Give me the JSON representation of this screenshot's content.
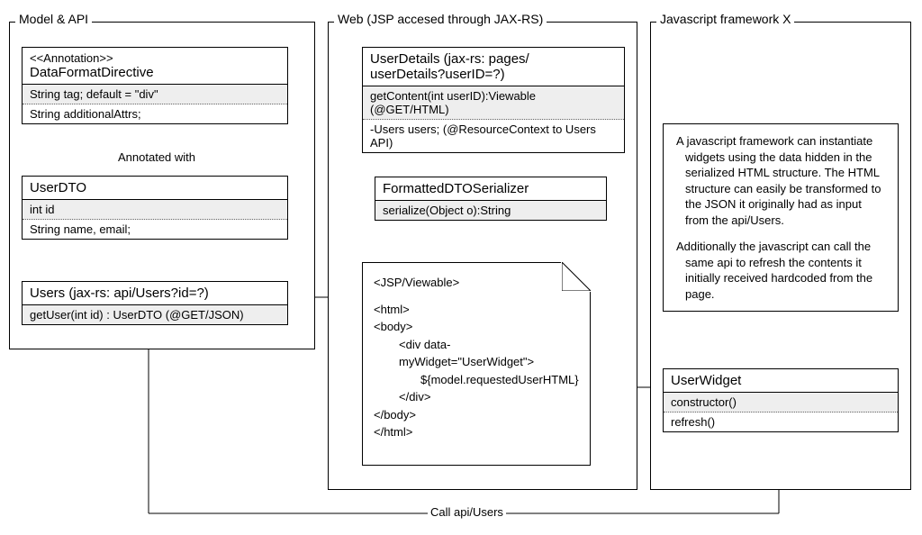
{
  "containers": {
    "model": {
      "label": "Model & API"
    },
    "web": {
      "label": "Web (JSP accesed through JAX-RS)"
    },
    "js": {
      "label": "Javascript framework X"
    }
  },
  "classes": {
    "dfd": {
      "stereo": "<<Annotation>>",
      "name": "DataFormatDirective",
      "row1": "String tag; default = \"div\"",
      "row2": "String additionalAttrs;"
    },
    "userdto": {
      "name": "UserDTO",
      "row1": "int id",
      "row2": "String name, email;"
    },
    "users": {
      "name": "Users (jax-rs: api/Users?id=?)",
      "row1": "getUser(int id) : UserDTO (@GET/JSON)"
    },
    "userdetails": {
      "name": "UserDetails (jax-rs: pages/\nuserDetails?userID=?)",
      "row1": "getContent(int userID):Viewable (@GET/HTML)",
      "row2": "-Users users; (@ResourceContext to Users API)"
    },
    "serializer": {
      "name": "FormattedDTOSerializer",
      "row1": "serialize(Object o):String"
    },
    "userwidget": {
      "name": "UserWidget",
      "row1": "constructor()",
      "row2": "refresh()"
    }
  },
  "doc": {
    "l1": "<JSP/Viewable>",
    "l2": "<html>",
    "l3": "<body>",
    "l4": "<div data-myWidget=\"UserWidget\">",
    "l5": "${model.requestedUserHTML}",
    "l6": "</div>",
    "l7": "</body>",
    "l8": "</html>"
  },
  "note": {
    "p1": "A javascript framework can instantiate widgets using the data hidden in the serialized HTML structure. The HTML structure can easily be transformed to the JSON it originally had as input from the api/Users.",
    "p2": "Additionally the javascript can call the same api to refresh the contents it initially received hardcoded from the page."
  },
  "labels": {
    "annotated": "Annotated with",
    "callapi": "Call api/Users"
  }
}
